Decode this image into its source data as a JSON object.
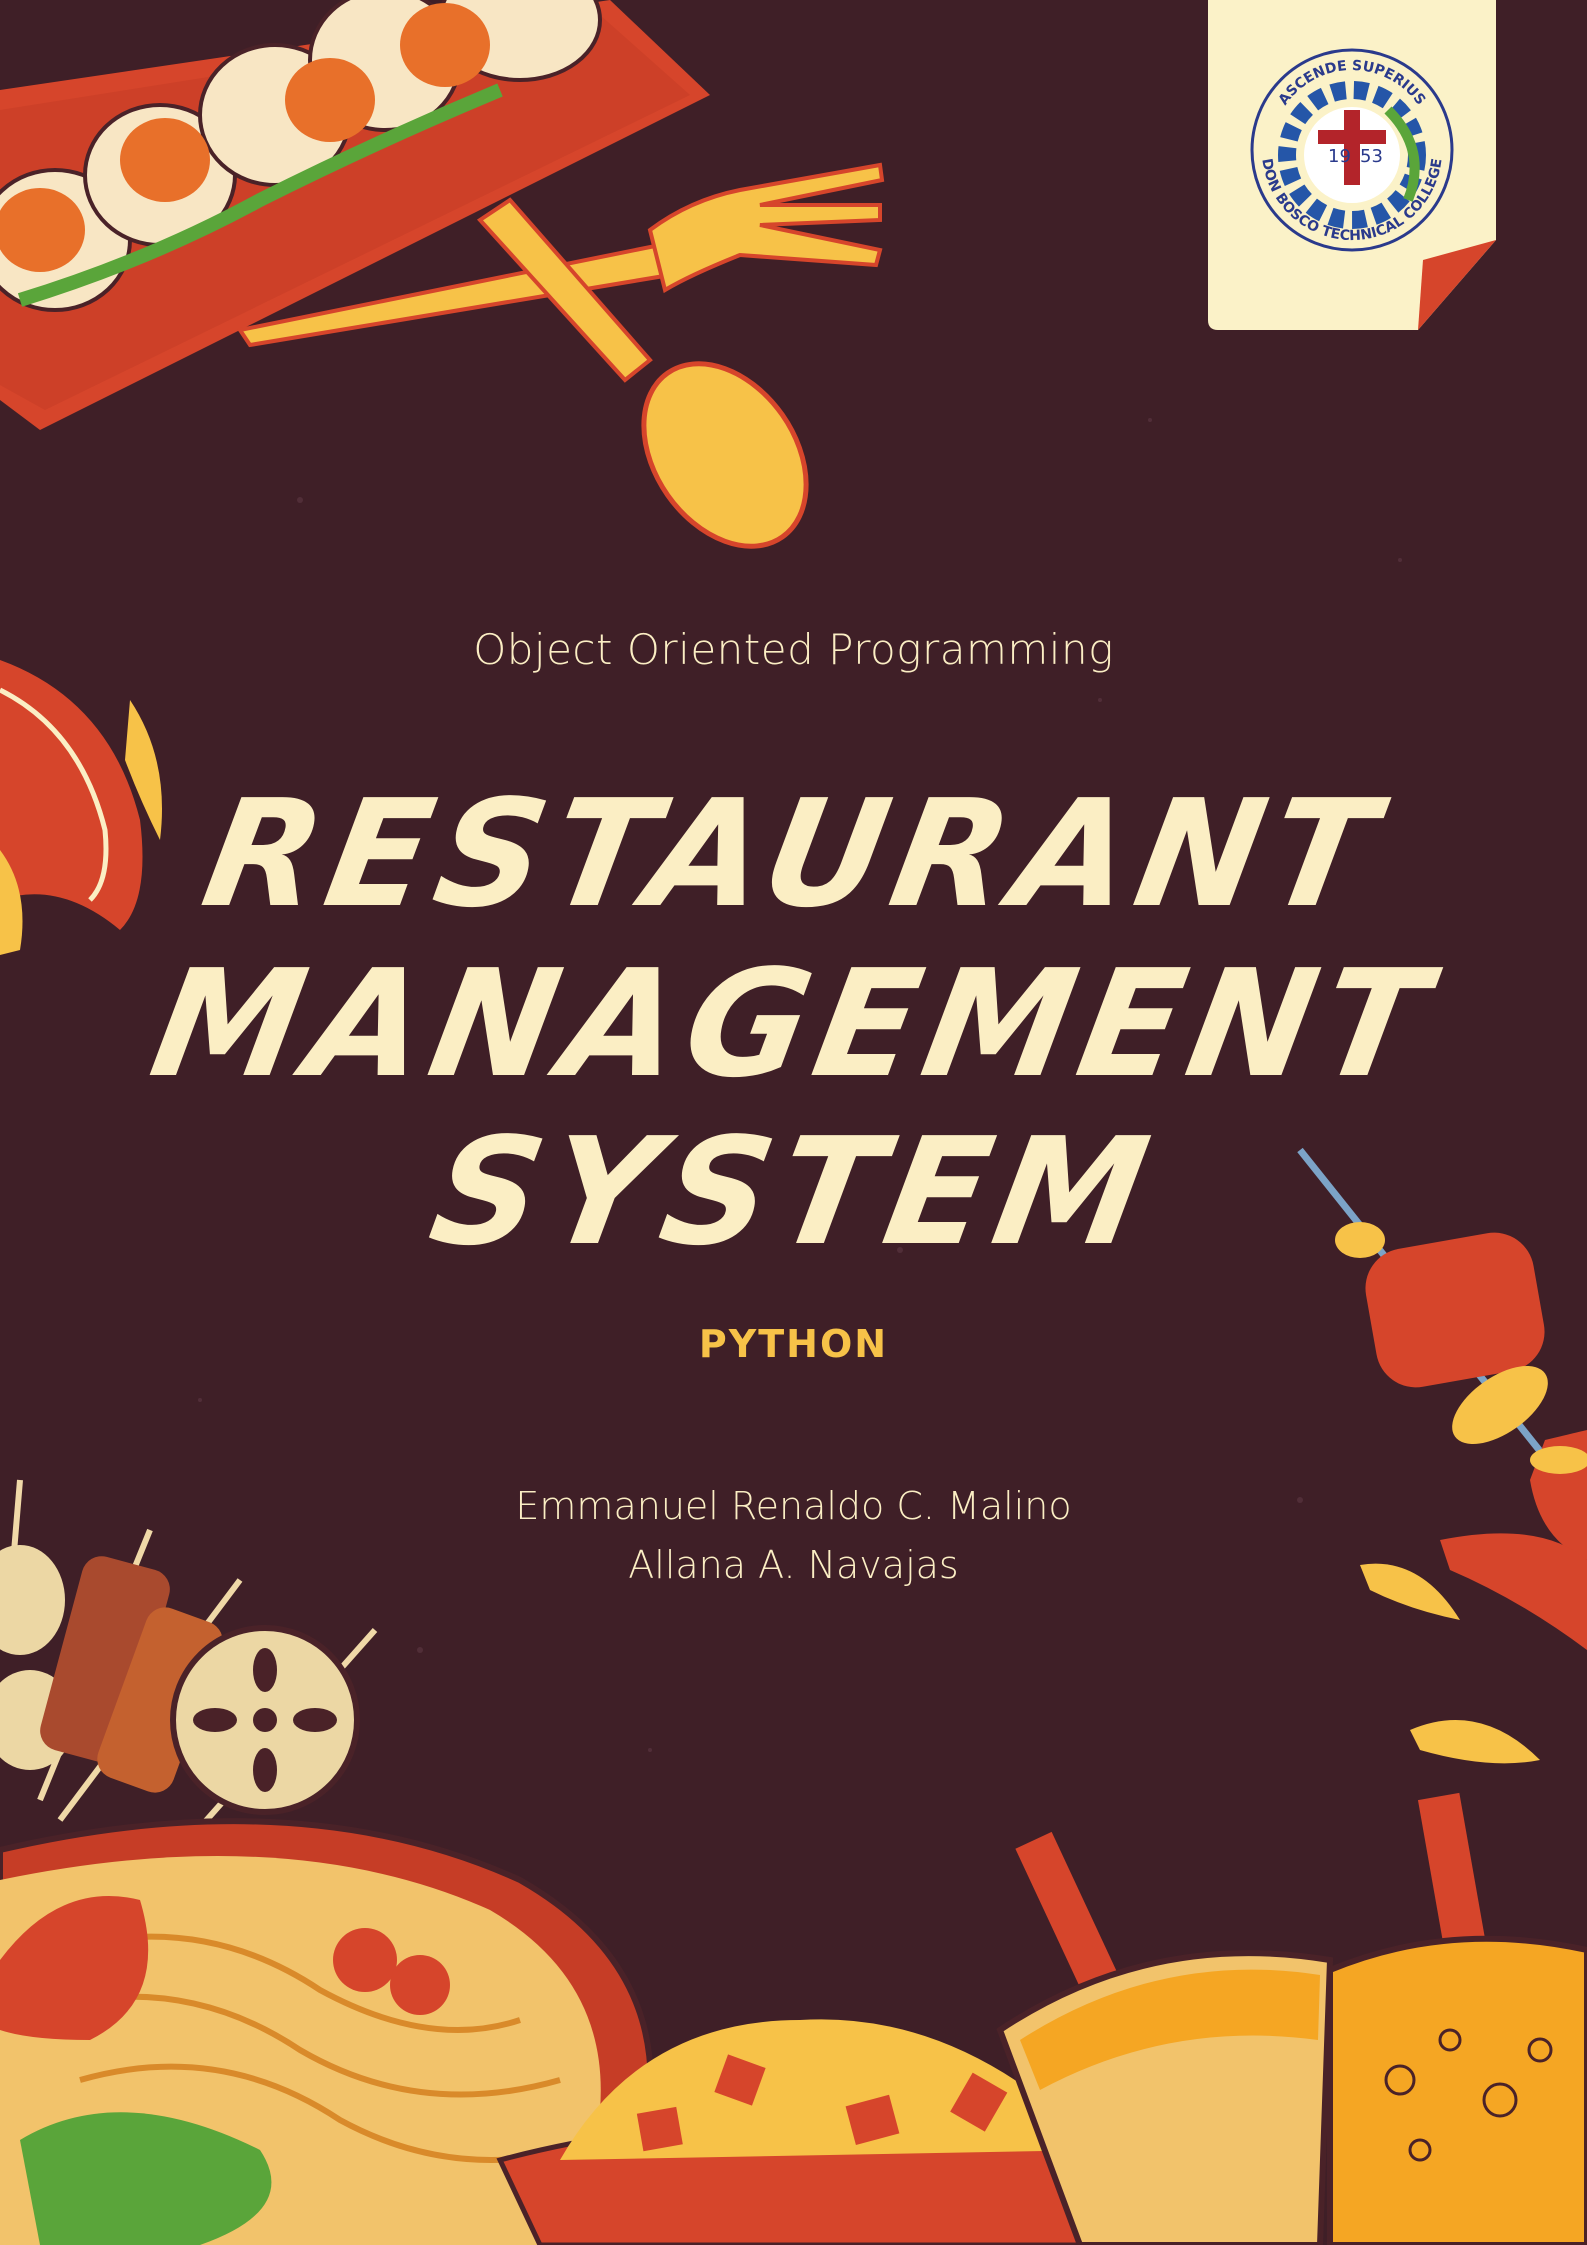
{
  "cover": {
    "subtitle": "Object Oriented Programming",
    "title_lines": [
      "RESTAURANT",
      "MANAGEMENT",
      "SYSTEM"
    ],
    "language": "PYTHON",
    "authors": [
      "Emmanuel Renaldo C. Malino",
      "Allana A. Navajas"
    ]
  },
  "seal": {
    "motto": "ASCENDE SUPERIUS",
    "school": "DON BOSCO TECHNICAL COLLEGE",
    "year_left": "19",
    "year_right": "53"
  },
  "colors": {
    "background": "#3f1f27",
    "title_text": "#fbeec4",
    "accent_yellow": "#f7c248",
    "accent_red": "#d6452b"
  },
  "icons": [
    "sushi-plate-icon",
    "fork-icon",
    "spoon-icon",
    "flame-icon",
    "skewer-icon",
    "noodle-bowl-icon",
    "fried-rice-icon",
    "drink-cup-icon",
    "seal-logo"
  ]
}
